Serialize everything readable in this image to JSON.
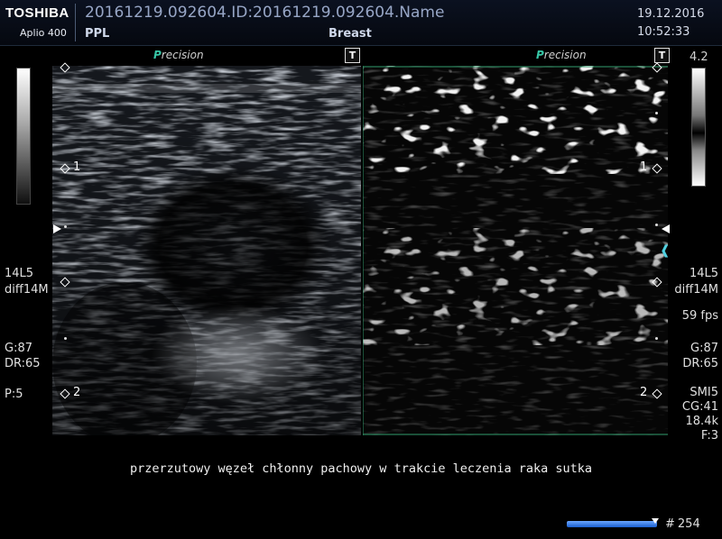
{
  "header": {
    "brand": "TOSHIBA",
    "model": "Aplio 400",
    "study_id": "20161219.092604.ID:20161219.092604.Name",
    "preset": "PPL",
    "organ": "Breast",
    "date": "19.12.2016",
    "time": "10:52:33"
  },
  "precision_label": {
    "prefix": "P",
    "rest": "recision"
  },
  "t_badge": "T",
  "left_params": {
    "probe": "14L5",
    "mode": "diff14M",
    "gain": "G:87",
    "dynamic_range": "DR:65",
    "p": "P:5"
  },
  "right_params": {
    "scale_max": "4.2",
    "probe": "14L5",
    "mode": "diff14M",
    "fps": "59 fps",
    "gain": "G:87",
    "dynamic_range": "DR:65",
    "smi": "SMI5",
    "color_gain": "CG:41",
    "prf": "18.4k",
    "filter": "F:3"
  },
  "depth_markers": {
    "one": "1",
    "two": "2"
  },
  "caption": "przerzutowy węzeł chłonny pachowy w trakcie leczenia raka sutka",
  "cine": {
    "hash": "#",
    "frame": "254"
  },
  "colors": {
    "smi_accent": "#37c6a6",
    "cine": "#1a5fd0",
    "cyan_marker": "#4fd0e0"
  }
}
